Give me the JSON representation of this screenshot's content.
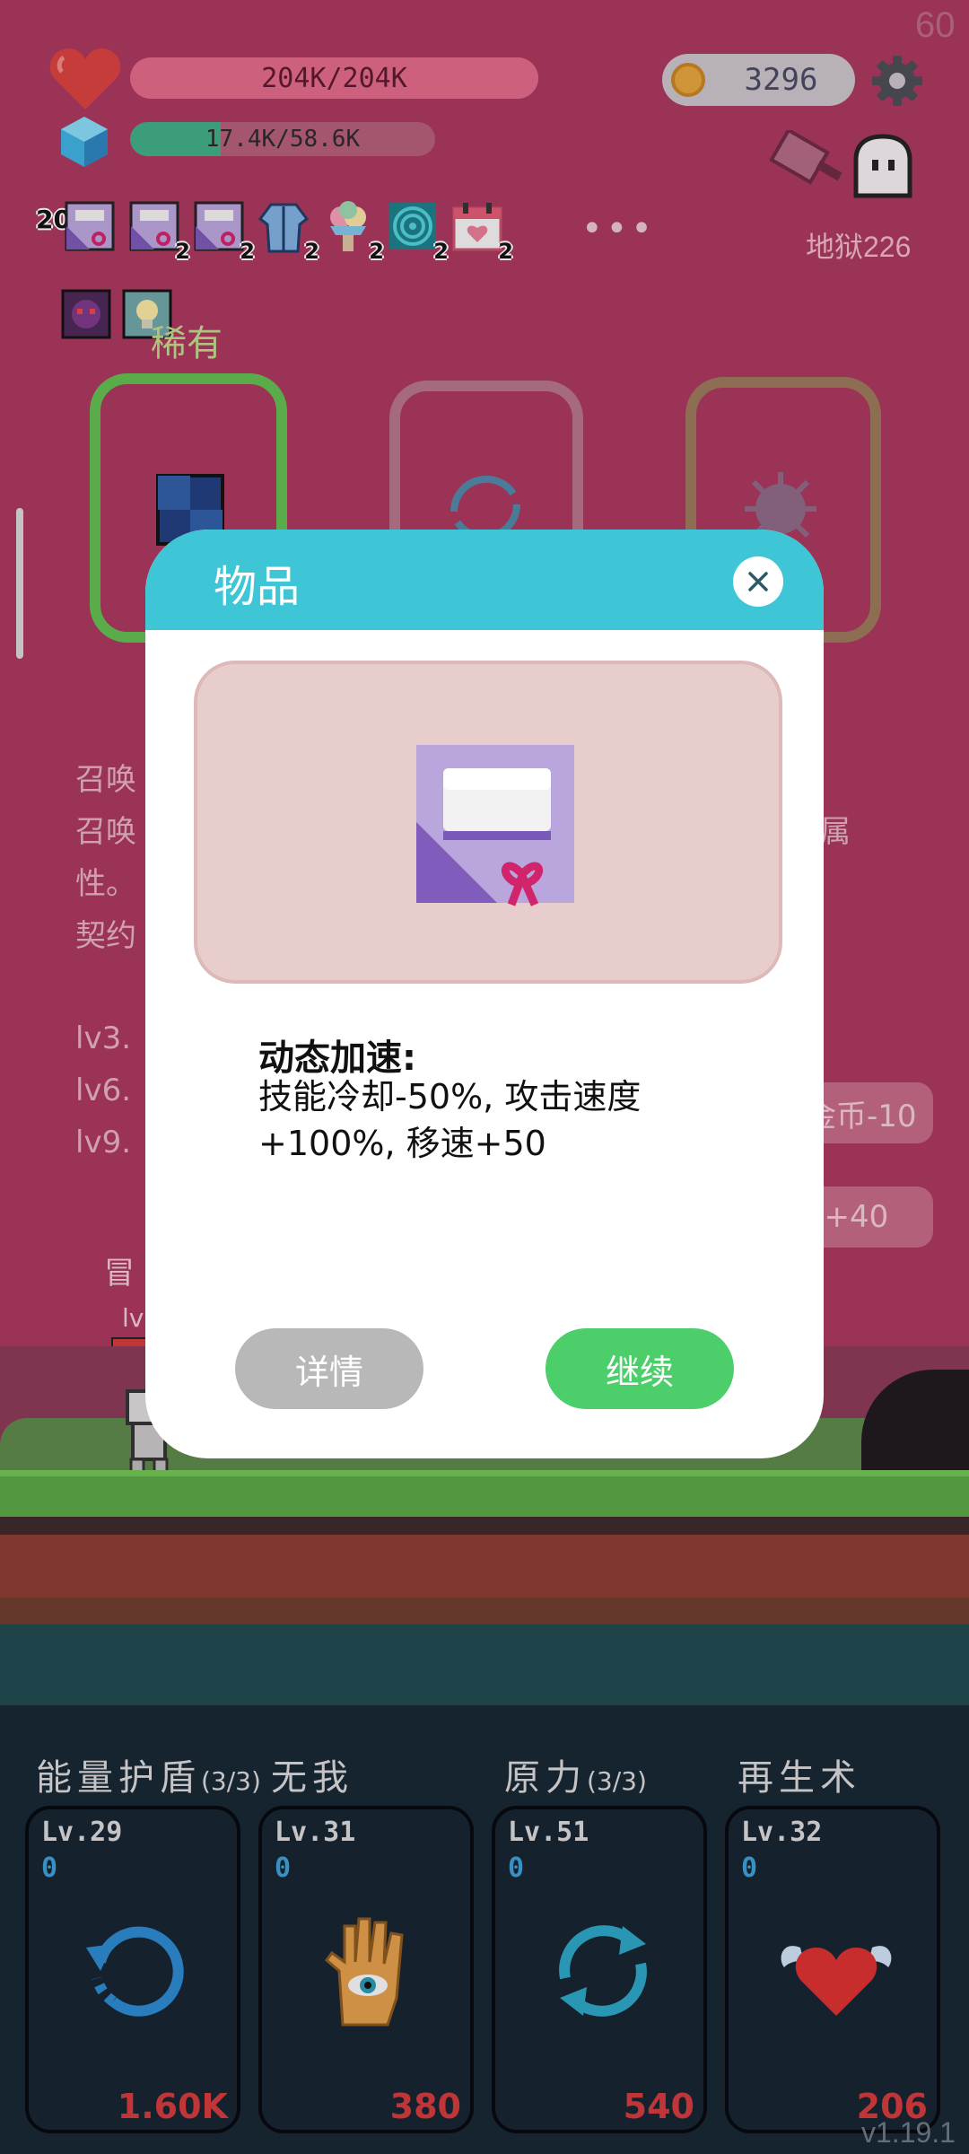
{
  "hud": {
    "hp_text": "204K/204K",
    "hp_fraction": 1.0,
    "xp_text": "17.4K/58.6K",
    "xp_fraction": 0.297,
    "coins": "3296",
    "fps": "60",
    "stage": "地狱226"
  },
  "buffs": {
    "first_count": "20",
    "items": [
      {
        "name": "dynamic-speed-buff-icon",
        "count": ""
      },
      {
        "name": "dynamic-speed-buff-icon",
        "count": "2"
      },
      {
        "name": "dynamic-speed-buff-icon",
        "count": "2"
      },
      {
        "name": "robe-buff-icon",
        "count": "2"
      },
      {
        "name": "ice-cream-buff-icon",
        "count": "2"
      },
      {
        "name": "spiral-buff-icon",
        "count": "2"
      },
      {
        "name": "calendar-buff-icon",
        "count": "2"
      }
    ],
    "more": "•••"
  },
  "rarity_label": "稀有",
  "background_text": {
    "lines": [
      "召唤",
      "召唤",
      "性。",
      "契约"
    ],
    "right_fragment": "属",
    "levels": [
      "lv3.",
      "lv6.",
      "lv9."
    ],
    "pill_coins": "金币-10",
    "pill_hp": "P+40",
    "adventurer_label": "冒",
    "adventurer_lv": "lv"
  },
  "modal": {
    "title": "物品",
    "item_name": "动态加速:",
    "item_desc": "技能冷却-50%, 攻击速度+100%, 移速+50",
    "details_label": "详情",
    "continue_label": "继续"
  },
  "skills": [
    {
      "title": "能量护盾",
      "charges": "(3/3)",
      "level": "Lv.29",
      "zero": "0",
      "cost": "1.60K",
      "icon": "energy-shield-icon"
    },
    {
      "title": "无我",
      "charges": "",
      "level": "Lv.31",
      "zero": "0",
      "cost": "380",
      "icon": "eye-hand-icon"
    },
    {
      "title": "原力",
      "charges": "(3/3)",
      "level": "Lv.51",
      "zero": "0",
      "cost": "540",
      "icon": "force-cycle-icon"
    },
    {
      "title": "再生术",
      "charges": "",
      "level": "Lv.32",
      "zero": "0",
      "cost": "206",
      "icon": "winged-heart-icon"
    }
  ],
  "version": "v1.19.1",
  "colors": {
    "background": "#a8385d",
    "modal_header": "#3ec6d6",
    "continue_button": "#4ccf6a",
    "details_button": "#b8b8b8",
    "skill_cost": "#d23a3a"
  }
}
